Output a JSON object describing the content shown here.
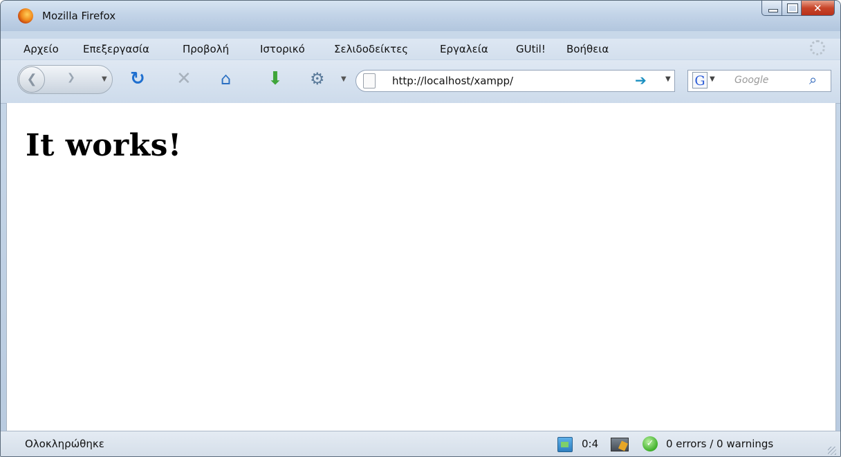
{
  "window": {
    "title": "Mozilla Firefox"
  },
  "menubar": {
    "items": [
      "Αρχείο",
      "Επεξεργασία",
      "Προβολή",
      "Ιστορικό",
      "Σελιδοδείκτες",
      "Εργαλεία",
      "GUtil!",
      "Βοήθεια"
    ]
  },
  "navbar": {
    "url": "http://localhost/xampp/",
    "search_placeholder": "Google"
  },
  "content": {
    "heading": "It works!"
  },
  "statusbar": {
    "status": "Ολοκληρώθηκε",
    "count": "0:4",
    "errors": "0 errors / 0 warnings"
  },
  "icons": [
    "firefox-icon",
    "back-icon",
    "forward-icon",
    "reload-icon",
    "stop-icon",
    "home-icon",
    "download-icon",
    "google-toolbar-icon",
    "page-icon",
    "go-arrow-icon",
    "google-g-icon",
    "search-icon",
    "throbber-icon",
    "status-screen-icon",
    "status-toolbar-icon",
    "checkmark-icon",
    "resize-grip-icon"
  ],
  "colors": {
    "accent": "#1a8fc0",
    "reload": "#1f6fcf",
    "download": "#3fa53a"
  }
}
